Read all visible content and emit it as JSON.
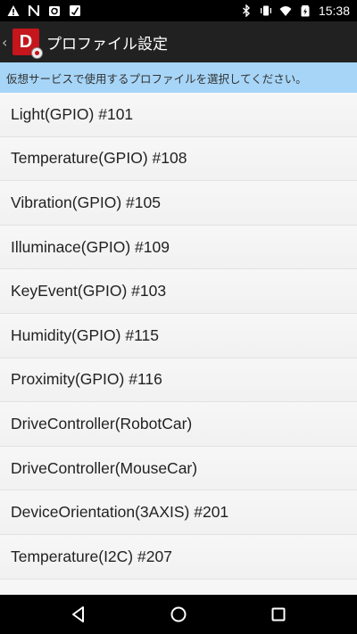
{
  "status_bar": {
    "time": "15:38",
    "left_icons": [
      "warning-icon",
      "no-sim-icon",
      "sync-icon",
      "download-icon"
    ],
    "right_icons": [
      "bluetooth-icon",
      "vibrate-icon",
      "wifi-icon",
      "battery-icon"
    ]
  },
  "app_bar": {
    "back_symbol": "‹",
    "logo_letter": "D",
    "title": "プロファイル設定"
  },
  "banner": {
    "text": "仮想サービスで使用するプロファイルを選択してください。"
  },
  "profiles": [
    "Light(GPIO) #101",
    "Temperature(GPIO) #108",
    "Vibration(GPIO) #105",
    "Illuminace(GPIO) #109",
    "KeyEvent(GPIO) #103",
    "Humidity(GPIO) #115",
    "Proximity(GPIO) #116",
    "DriveController(RobotCar)",
    "DriveController(MouseCar)",
    "DeviceOrientation(3AXIS) #201",
    "Temperature(I2C) #207",
    ""
  ],
  "nav_bar": {
    "buttons": [
      "back-triangle-icon",
      "home-circle-icon",
      "recents-square-icon"
    ]
  }
}
